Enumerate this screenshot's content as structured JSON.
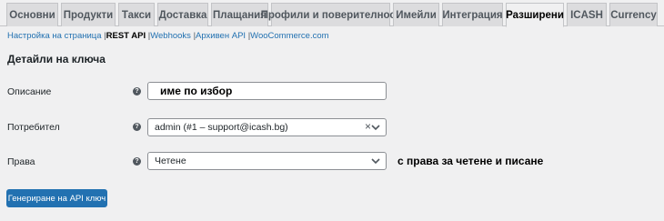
{
  "tabs": [
    {
      "label": "Основни"
    },
    {
      "label": "Продукти"
    },
    {
      "label": "Такси"
    },
    {
      "label": "Доставка"
    },
    {
      "label": "Плащания"
    },
    {
      "label": "Профили и поверителност"
    },
    {
      "label": "Имейли"
    },
    {
      "label": "Интеграция"
    },
    {
      "label": "Разширени",
      "active": true
    },
    {
      "label": "ICASH"
    },
    {
      "label": "Currency"
    }
  ],
  "subnav": {
    "page_setup": "Настройка на страница",
    "rest_api": "REST API",
    "webhooks": "Webhooks",
    "legacy_api": "Архивен API",
    "woocommerce_com": "WooCommerce.com",
    "separator": "|"
  },
  "section_title": "Детайли на ключа",
  "form": {
    "description": {
      "label": "Описание",
      "value": "име по избор"
    },
    "user": {
      "label": "Потребител",
      "value": "admin (#1 – support@icash.bg)",
      "clear_symbol": "×"
    },
    "permissions": {
      "label": "Права",
      "value": "Четене",
      "note": "с права за четене и писане"
    },
    "help_symbol": "?"
  },
  "generate_button": "Генериране на API ключ",
  "colors": {
    "accent": "#2271b1",
    "background": "#f0f0f1",
    "tab_inactive": "#dcdcde"
  }
}
